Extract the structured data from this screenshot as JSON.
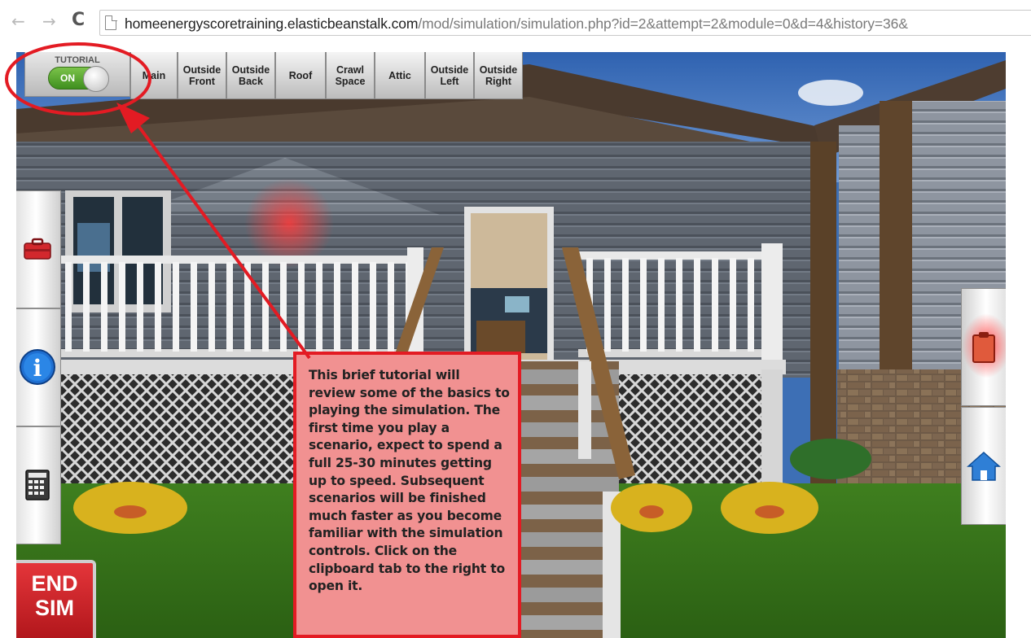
{
  "browser": {
    "back_icon": "←",
    "forward_icon": "→",
    "reload_icon": "C",
    "url_host": "homeenergyscoretraining.elasticbeanstalk.com",
    "url_path": "/mod/simulation/simulation.php?id=2&attempt=2&module=0&d=4&history=36&"
  },
  "tutorial": {
    "label": "TUTORIAL",
    "toggle_state": "ON"
  },
  "tabs": [
    {
      "line1": "Main",
      "line2": ""
    },
    {
      "line1": "Outside",
      "line2": "Front"
    },
    {
      "line1": "Outside",
      "line2": "Back"
    },
    {
      "line1": "Roof",
      "line2": ""
    },
    {
      "line1": "Crawl",
      "line2": "Space"
    },
    {
      "line1": "Attic",
      "line2": ""
    },
    {
      "line1": "Outside",
      "line2": "Left"
    },
    {
      "line1": "Outside",
      "line2": "Right"
    }
  ],
  "left_tools": [
    {
      "icon": "toolbox-icon"
    },
    {
      "icon": "info-icon",
      "glyph": "i"
    },
    {
      "icon": "calculator-icon"
    }
  ],
  "right_tools": [
    {
      "icon": "clipboard-icon"
    },
    {
      "icon": "home-icon"
    }
  ],
  "end_sim": {
    "line1": "END",
    "line2": "SIM"
  },
  "callout": {
    "text": "This brief tutorial will review some of the basics to playing the simulation. The first time you play a scenario, expect to spend a full 25-30 minutes getting up to speed. Subsequent scenarios will be finished much faster as you become familiar with the simulation controls.  Click on the clipboard tab to the right to open it."
  },
  "colors": {
    "annotation_red": "#e31b23",
    "callout_fill": "#f19191",
    "end_sim_red": "#c4262b",
    "toggle_green": "#5aa832",
    "info_blue": "#1f6fd1"
  }
}
